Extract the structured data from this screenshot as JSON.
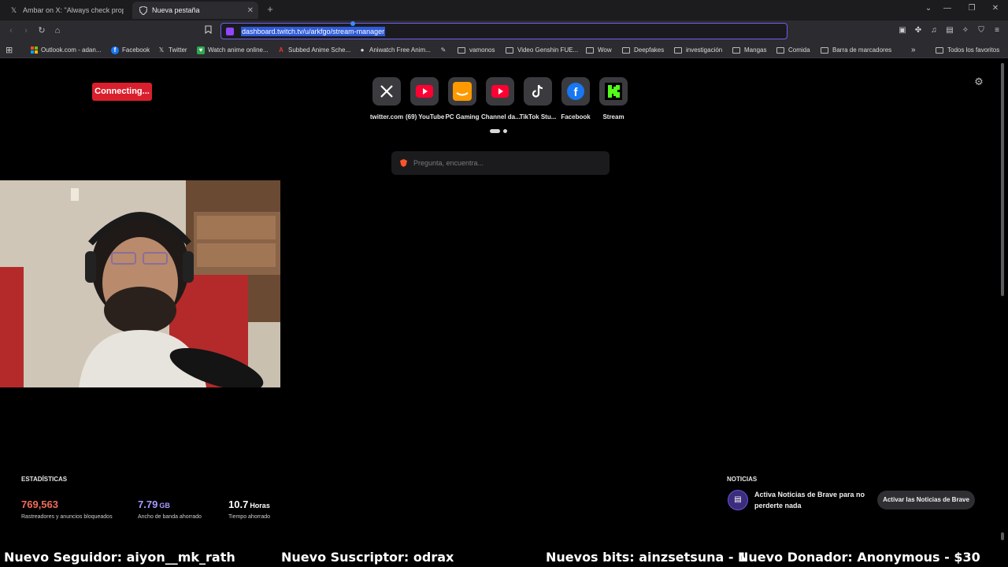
{
  "tabs": [
    {
      "title": "Ambar on X: \"Always check properly",
      "icon": "x-logo-icon",
      "active": false
    },
    {
      "title": "Nueva pestaña",
      "icon": "brave-shield-icon",
      "active": true
    }
  ],
  "address_bar": {
    "url": "dashboard.twitch.tv/u/arkfgo/stream-manager"
  },
  "bookmarks": [
    {
      "label": "Outlook.com - adan...",
      "icon": "microsoft-icon"
    },
    {
      "label": "Facebook",
      "icon": "facebook-icon"
    },
    {
      "label": "Twitter",
      "icon": "x-logo-icon"
    },
    {
      "label": "Watch anime online...",
      "icon": "anime-icon"
    },
    {
      "label": "Subbed Anime Sche...",
      "icon": "anime-schedule-icon"
    },
    {
      "label": "Aniwatch Free Anim...",
      "icon": "aniwatch-icon"
    },
    {
      "label": "",
      "icon": "misc-icon"
    },
    {
      "label": "vamonos",
      "icon": "folder-icon"
    },
    {
      "label": "Video Genshin FUE...",
      "icon": "folder-icon"
    },
    {
      "label": "Wow",
      "icon": "folder-icon"
    },
    {
      "label": "Deepfakes",
      "icon": "folder-icon"
    },
    {
      "label": "investigación",
      "icon": "folder-icon"
    },
    {
      "label": "Mangas",
      "icon": "folder-icon"
    },
    {
      "label": "Comida",
      "icon": "folder-icon"
    },
    {
      "label": "Barra de marcadores",
      "icon": "folder-icon"
    }
  ],
  "other_bookmarks": "Todos los favoritos",
  "connecting_badge": "Connecting...",
  "top_sites": [
    {
      "label": "twitter.com",
      "icon": "x-logo-icon",
      "color": "#ffffff"
    },
    {
      "label": "(69) YouTube",
      "icon": "youtube-icon",
      "color": "#ff0033"
    },
    {
      "label": "PC Gaming",
      "icon": "amazon-icon",
      "color": "#ff9900"
    },
    {
      "label": "Channel da...",
      "icon": "youtube-icon",
      "color": "#ff0033"
    },
    {
      "label": "TikTok Stu...",
      "icon": "tiktok-icon",
      "color": "#ffffff"
    },
    {
      "label": "Facebook",
      "icon": "facebook-icon",
      "color": "#1877f2"
    },
    {
      "label": "Stream",
      "icon": "kick-icon",
      "color": "#53fc18"
    }
  ],
  "search": {
    "placeholder": "Pregunta, encuentra..."
  },
  "stats": {
    "title": "ESTADÍSTICAS",
    "items": [
      {
        "value": "769,563",
        "unit": "",
        "label": "Rastreadores y anuncios bloqueados",
        "color": "#f26b5b"
      },
      {
        "value": "7.79",
        "unit": "GB",
        "label": "Ancho de banda ahorrado",
        "color": "#a79bff"
      },
      {
        "value": "10.7",
        "unit": "Horas",
        "label": "Tiempo ahorrado",
        "color": "#ffffff"
      }
    ]
  },
  "news": {
    "title": "NOTICIAS",
    "text": "Activa Noticias de Brave para no perderte nada",
    "button": "Activar las Noticias de Brave"
  },
  "ticker": [
    "Nuevo Seguidor: aiyon__mk_rath",
    "Nuevo Suscriptor: odrax",
    "Nuevos bits: ainzsetsuna - 1",
    "Nuevo Donador: Anonymous - $30"
  ]
}
